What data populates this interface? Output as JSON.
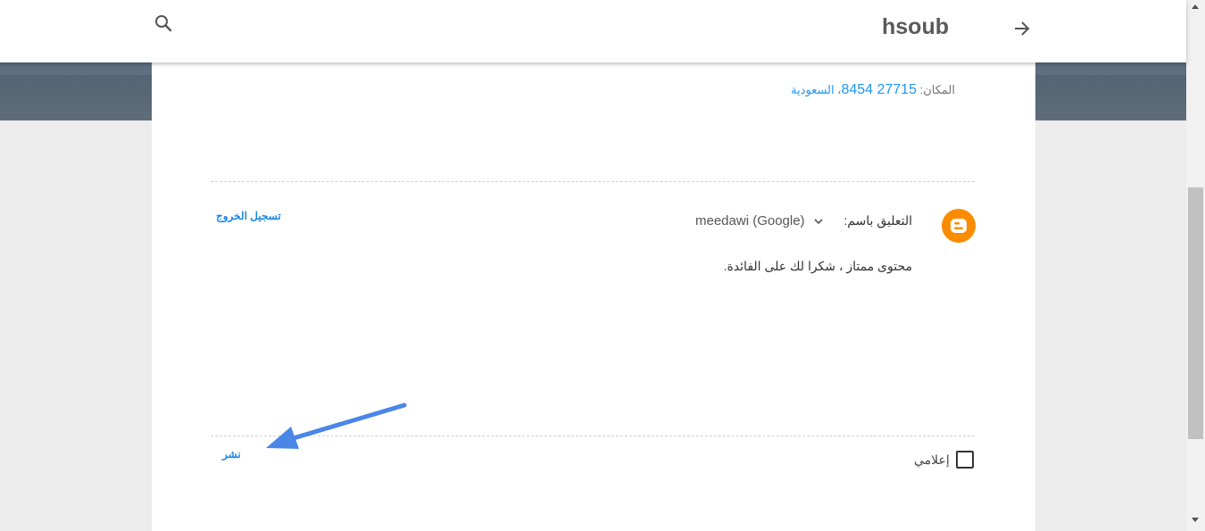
{
  "header": {
    "blog_title": "hsoub"
  },
  "post": {
    "location_label": "المكان:",
    "location_number": "27715 8454",
    "location_country": "، السعودية"
  },
  "comment_form": {
    "comment_as_label": "التعليق باسم:",
    "account": "meedawi (Google)",
    "signout_label": "تسجيل الخروج",
    "comment_text": "محتوى ممتاز ، شكرا لك على الفائدة.",
    "notify_label": "إعلامي",
    "notify_checked": false,
    "publish_label": "نشر"
  },
  "icons": {
    "search": "search-icon",
    "back": "arrow-right-icon",
    "blogger": "blogger-logo-icon",
    "dropdown": "chevron-down-icon"
  },
  "colors": {
    "link": "#1e88e5",
    "blogger_orange": "#fb8c00",
    "annotation_arrow": "#4a86e8"
  }
}
